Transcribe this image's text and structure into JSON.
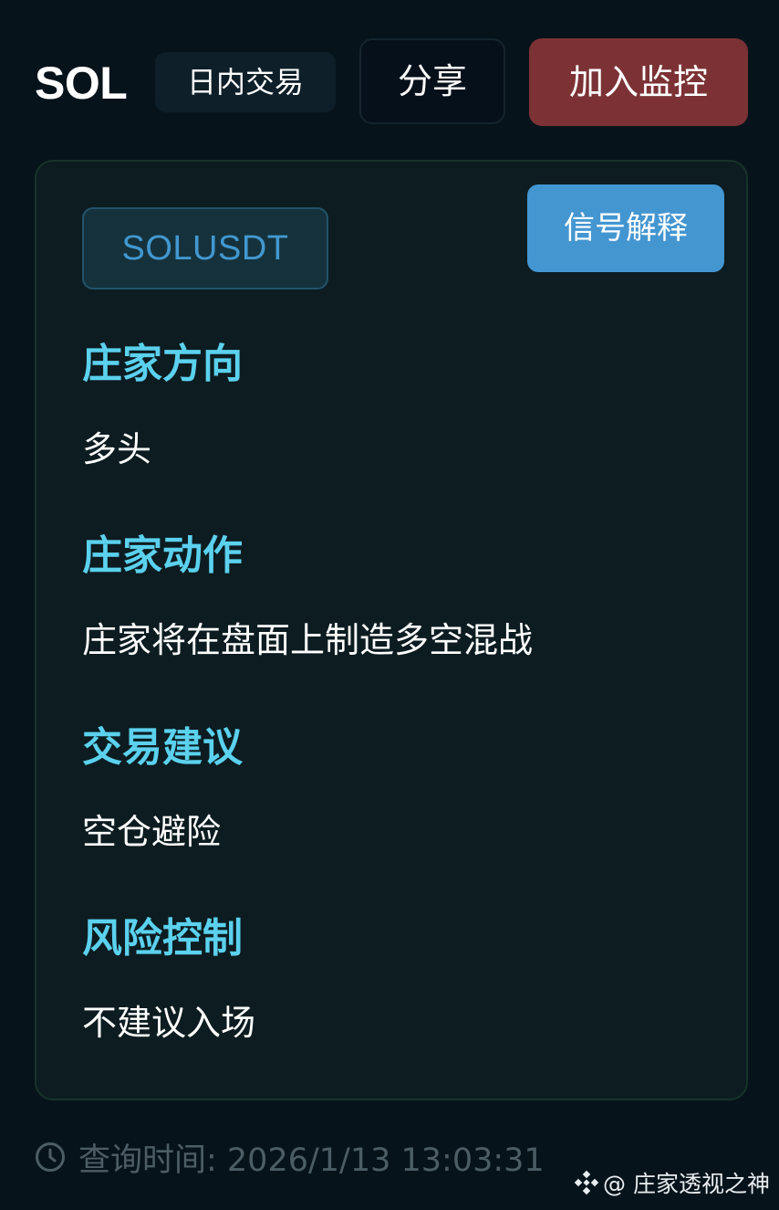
{
  "header": {
    "symbol": "SOL",
    "mode": "日内交易",
    "share_label": "分享",
    "monitor_label": "加入监控"
  },
  "card": {
    "pair": "SOLUSDT",
    "explain_label": "信号解释",
    "sections": [
      {
        "title": "庄家方向",
        "value": "多头"
      },
      {
        "title": "庄家动作",
        "value": "庄家将在盘面上制造多空混战"
      },
      {
        "title": "交易建议",
        "value": "空仓避险"
      },
      {
        "title": "风险控制",
        "value": "不建议入场"
      }
    ]
  },
  "footer": {
    "query_time_label": "查询时间: 2026/1/13 13:03:31",
    "icon": "clock-icon"
  },
  "watermark": {
    "text": "@ 庄家透视之神",
    "icon": "binance-logo-icon"
  },
  "colors": {
    "background": "#07131a",
    "card_background": "#0c1c20",
    "accent_title": "#5bd1ee",
    "monitor_button": "#7c3235",
    "explain_button": "#4496d1",
    "pair_text": "#4298d0"
  }
}
